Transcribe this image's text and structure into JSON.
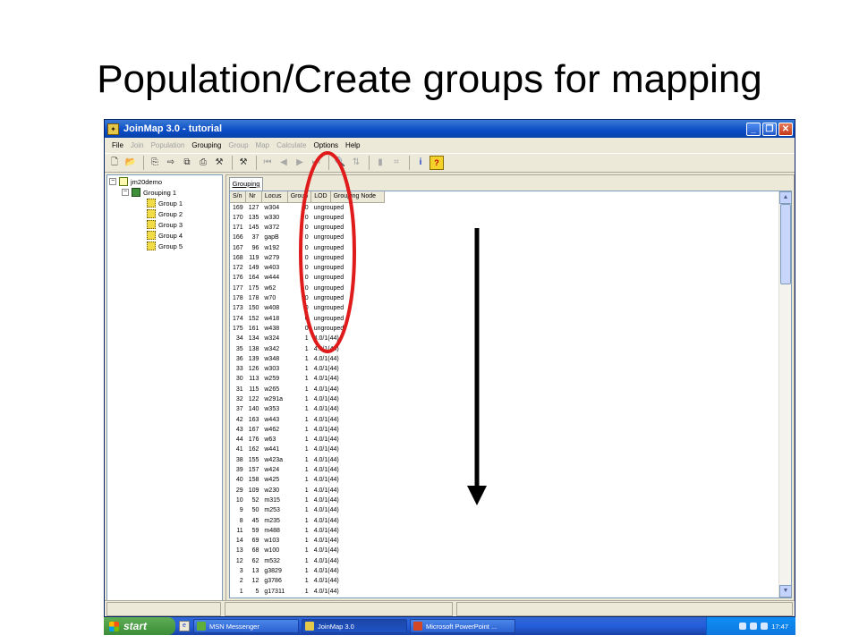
{
  "slide": {
    "title": "Population/Create groups for mapping"
  },
  "window": {
    "title": "JoinMap 3.0  -  tutorial",
    "icon": "joinmap-icon",
    "buttons": {
      "minimize": "_",
      "maximize": "❐",
      "close": "✕"
    }
  },
  "menu": [
    {
      "label": "File",
      "enabled": true
    },
    {
      "label": "Join",
      "enabled": false
    },
    {
      "label": "Population",
      "enabled": false
    },
    {
      "label": "Grouping",
      "enabled": true
    },
    {
      "label": "Group",
      "enabled": false
    },
    {
      "label": "Map",
      "enabled": false
    },
    {
      "label": "Calculate",
      "enabled": false
    },
    {
      "label": "Options",
      "enabled": true
    },
    {
      "label": "Help",
      "enabled": true
    }
  ],
  "toolbar": {
    "info_glyph": "i",
    "help_glyph": "?"
  },
  "tree": {
    "root": {
      "label": "jm20demo",
      "toggle": "−"
    },
    "grouping": {
      "label": "Grouping 1",
      "toggle": "−"
    },
    "groups": [
      "Group 1",
      "Group 2",
      "Group 3",
      "Group 4",
      "Group 5"
    ]
  },
  "tab": {
    "label": "Grouping"
  },
  "table": {
    "columns": [
      "S/n",
      "Nr",
      "Locus",
      "Group",
      "LOD",
      "Grouping Node"
    ],
    "rows": [
      [
        "169",
        "127",
        "w304",
        "0",
        "ungrouped"
      ],
      [
        "170",
        "135",
        "w330",
        "0",
        "ungrouped"
      ],
      [
        "171",
        "145",
        "w372",
        "0",
        "ungrouped"
      ],
      [
        "166",
        "37",
        "gapB",
        "0",
        "ungrouped"
      ],
      [
        "167",
        "96",
        "w192",
        "0",
        "ungrouped"
      ],
      [
        "168",
        "119",
        "w279",
        "0",
        "ungrouped"
      ],
      [
        "172",
        "149",
        "w403",
        "0",
        "ungrouped"
      ],
      [
        "176",
        "164",
        "w444",
        "0",
        "ungrouped"
      ],
      [
        "177",
        "175",
        "w62",
        "0",
        "ungrouped"
      ],
      [
        "178",
        "178",
        "w70",
        "0",
        "ungrouped"
      ],
      [
        "173",
        "150",
        "w408",
        "0",
        "ungrouped"
      ],
      [
        "174",
        "152",
        "w418",
        "0",
        "ungrouped"
      ],
      [
        "175",
        "161",
        "w438",
        "0",
        "ungrouped"
      ],
      [
        "34",
        "134",
        "w324",
        "1",
        "4.0/1(44)"
      ],
      [
        "35",
        "138",
        "w342",
        "1",
        "4.0/1(44)"
      ],
      [
        "36",
        "139",
        "w348",
        "1",
        "4.0/1(44)"
      ],
      [
        "33",
        "126",
        "w303",
        "1",
        "4.0/1(44)"
      ],
      [
        "30",
        "113",
        "w259",
        "1",
        "4.0/1(44)"
      ],
      [
        "31",
        "115",
        "w265",
        "1",
        "4.0/1(44)"
      ],
      [
        "32",
        "122",
        "w291a",
        "1",
        "4.0/1(44)"
      ],
      [
        "37",
        "140",
        "w353",
        "1",
        "4.0/1(44)"
      ],
      [
        "42",
        "163",
        "w443",
        "1",
        "4.0/1(44)"
      ],
      [
        "43",
        "167",
        "w462",
        "1",
        "4.0/1(44)"
      ],
      [
        "44",
        "176",
        "w63",
        "1",
        "4.0/1(44)"
      ],
      [
        "41",
        "162",
        "w441",
        "1",
        "4.0/1(44)"
      ],
      [
        "38",
        "155",
        "w423a",
        "1",
        "4.0/1(44)"
      ],
      [
        "39",
        "157",
        "w424",
        "1",
        "4.0/1(44)"
      ],
      [
        "40",
        "158",
        "w425",
        "1",
        "4.0/1(44)"
      ],
      [
        "29",
        "109",
        "w230",
        "1",
        "4.0/1(44)"
      ],
      [
        "10",
        "52",
        "m315",
        "1",
        "4.0/1(44)"
      ],
      [
        "9",
        "50",
        "m253",
        "1",
        "4.0/1(44)"
      ],
      [
        "8",
        "45",
        "m235",
        "1",
        "4.0/1(44)"
      ],
      [
        "11",
        "59",
        "m488",
        "1",
        "4.0/1(44)"
      ],
      [
        "14",
        "69",
        "w103",
        "1",
        "4.0/1(44)"
      ],
      [
        "13",
        "68",
        "w100",
        "1",
        "4.0/1(44)"
      ],
      [
        "12",
        "62",
        "m532",
        "1",
        "4.0/1(44)"
      ],
      [
        "3",
        "13",
        "g3829",
        "1",
        "4.0/1(44)"
      ],
      [
        "2",
        "12",
        "g3786",
        "1",
        "4.0/1(44)"
      ],
      [
        "1",
        "5",
        "g17311",
        "1",
        "4.0/1(44)"
      ]
    ]
  },
  "scrollbar": {
    "up_glyph": "▲",
    "down_glyph": "▼"
  },
  "taskbar": {
    "start": "start",
    "tasks": [
      {
        "label": "MSN Messenger",
        "active": false,
        "icon": "msn-icon",
        "color": "#5fae3a"
      },
      {
        "label": "JoinMap 3.0",
        "active": true,
        "icon": "joinmap-icon",
        "color": "#e5c84a"
      },
      {
        "label": "Microsoft PowerPoint ...",
        "active": false,
        "icon": "powerpoint-icon",
        "color": "#d24726"
      }
    ],
    "clock": "17:47"
  },
  "annotations": {
    "ellipse_color": "#e01b1b",
    "arrow_color": "#000000",
    "arrow_direction": "down"
  },
  "colors": {
    "titlebar": "#0a4bc6",
    "taskbar": "#245edb",
    "start_button": "#3c8d37"
  }
}
